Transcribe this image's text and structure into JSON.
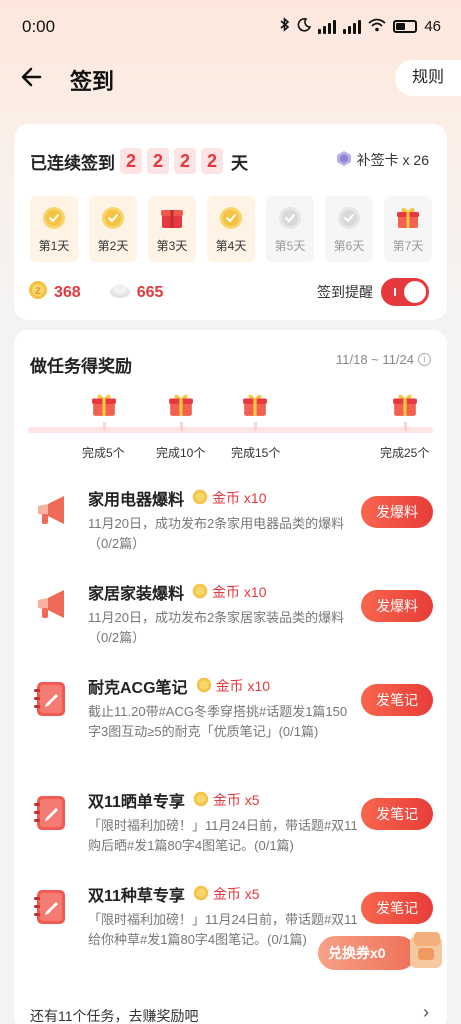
{
  "status_bar": {
    "time": "0:00",
    "battery": "46"
  },
  "header": {
    "title": "签到",
    "rules": "规则"
  },
  "signin": {
    "streak_prefix": "已连续签到",
    "digits": [
      "2",
      "2",
      "2",
      "2"
    ],
    "streak_suffix": "天",
    "makeup_label": "补签卡 x 26",
    "days": [
      {
        "label": "第1天",
        "state": "signed"
      },
      {
        "label": "第2天",
        "state": "signed"
      },
      {
        "label": "第3天",
        "state": "gift"
      },
      {
        "label": "第4天",
        "state": "signed"
      },
      {
        "label": "第5天",
        "state": "future"
      },
      {
        "label": "第6天",
        "state": "future"
      },
      {
        "label": "第7天",
        "state": "gift"
      }
    ],
    "coins": "368",
    "points": "665",
    "reminder_label": "签到提醒",
    "reminder_on": true
  },
  "tasks": {
    "title": "做任务得奖励",
    "date_range": "11/18 ~ 11/24",
    "milestones": [
      {
        "label": "完成5个"
      },
      {
        "label": "完成10个"
      },
      {
        "label": "完成15个"
      },
      {
        "label": "完成25个"
      }
    ],
    "items": [
      {
        "name": "家用电器爆料",
        "reward": "金币 x10",
        "desc": "11月20日，成功发布2条家用电器品类的爆料（0/2篇）",
        "button": "发爆料",
        "icon": "megaphone-icon"
      },
      {
        "name": "家居家装爆料",
        "reward": "金币 x10",
        "desc": "11月20日，成功发布2条家居家装品类的爆料（0/2篇）",
        "button": "发爆料",
        "icon": "megaphone-icon"
      },
      {
        "name": "耐克ACG笔记",
        "reward": "金币 x10",
        "desc": "截止11.20带#ACG冬季穿搭挑#话题发1篇150字3图互动≥5的耐克「优质笔记」(0/1篇)",
        "button": "发笔记",
        "icon": "notebook-icon"
      },
      {
        "name": "双11晒单专享",
        "reward": "金币 x5",
        "desc": "「限时福利加磅！」11月24日前，带话题#双11购后晒#发1篇80字4图笔记。(0/1篇)",
        "button": "发笔记",
        "icon": "notebook-icon"
      },
      {
        "name": "双11种草专享",
        "reward": "金币 x5",
        "desc": "「限时福利加磅！」11月24日前，带话题#双11给你种草#发1篇80字4图笔记。(0/1篇)",
        "button": "发笔记",
        "icon": "notebook-icon"
      }
    ],
    "more": "还有11个任务，去赚奖励吧"
  },
  "coupon": {
    "label": "兑换券x0"
  },
  "colors": {
    "accent": "#e8383f",
    "gold": "#f5c243",
    "bg_top": "#fde7dc"
  }
}
